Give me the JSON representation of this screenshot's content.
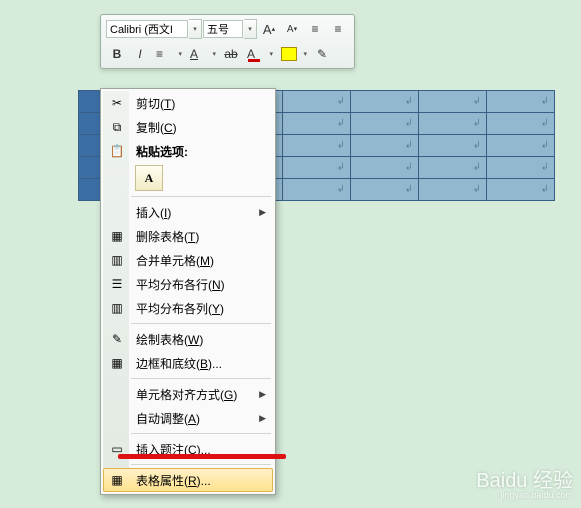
{
  "toolbar": {
    "font_name": "Calibri (西文I",
    "font_size": "五号",
    "grow_glyph": "A",
    "shrink_glyph": "A",
    "bold_glyph": "B",
    "italic_glyph": "I",
    "align_glyph": "≡",
    "underline_glyph": "A",
    "strike_glyph": "ab",
    "fontcolor_glyph": "A",
    "brush_glyph": "✎"
  },
  "menu": {
    "cut": {
      "label": "剪切(",
      "hotkey": "T",
      "tail": ")"
    },
    "copy": {
      "label": "复制(",
      "hotkey": "C",
      "tail": ")"
    },
    "paste_header": "粘贴选项:",
    "paste_keep": "A",
    "insert": {
      "label": "插入(",
      "hotkey": "I",
      "tail": ")"
    },
    "del_table": {
      "label": "删除表格(",
      "hotkey": "T",
      "tail": ")"
    },
    "merge": {
      "label": "合并单元格(",
      "hotkey": "M",
      "tail": ")"
    },
    "dist_rows": {
      "label": "平均分布各行(",
      "hotkey": "N",
      "tail": ")"
    },
    "dist_cols": {
      "label": "平均分布各列(",
      "hotkey": "Y",
      "tail": ")"
    },
    "draw": {
      "label": "绘制表格(",
      "hotkey": "W",
      "tail": ")"
    },
    "borders": {
      "label": "边框和底纹(",
      "hotkey": "B",
      "tail": ")..."
    },
    "cell_align": {
      "label": "单元格对齐方式(",
      "hotkey": "G",
      "tail": ")"
    },
    "autofit": {
      "label": "自动调整(",
      "hotkey": "A",
      "tail": ")"
    },
    "caption": {
      "label": "插入题注(",
      "hotkey": "C",
      "tail": ")..."
    },
    "props": {
      "label": "表格属性(",
      "hotkey": "R",
      "tail": ")..."
    }
  },
  "watermark": {
    "brand": "Baidu 经验",
    "sub": "jingyan.baidu.com"
  }
}
